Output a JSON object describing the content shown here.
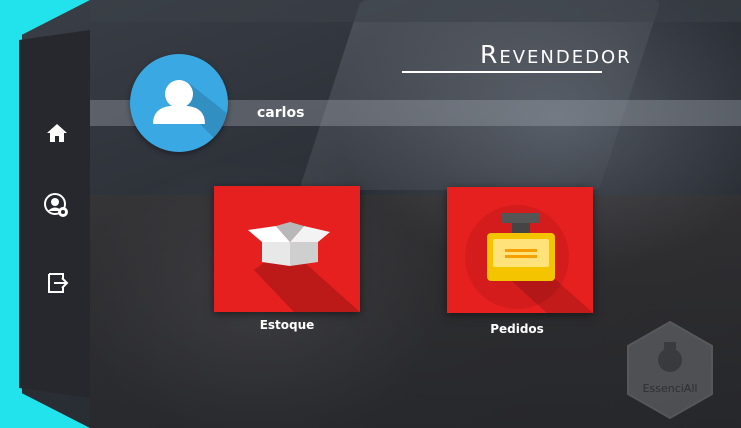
{
  "header": {
    "title": "Revendedor"
  },
  "user": {
    "name": "carlos"
  },
  "sidebar": {
    "items": [
      {
        "icon": "home-icon"
      },
      {
        "icon": "user-settings-icon"
      },
      {
        "icon": "logout-icon"
      }
    ]
  },
  "tiles": [
    {
      "label": "Estoque",
      "icon": "box-icon"
    },
    {
      "label": "Pedidos",
      "icon": "perfume-bottle-icon"
    }
  ],
  "watermark": {
    "text": "EssenciAll"
  },
  "colors": {
    "accent": "#22e3ec",
    "tile": "#e61f1f",
    "avatar": "#3aa8e3",
    "sidebar": "#26282e"
  }
}
